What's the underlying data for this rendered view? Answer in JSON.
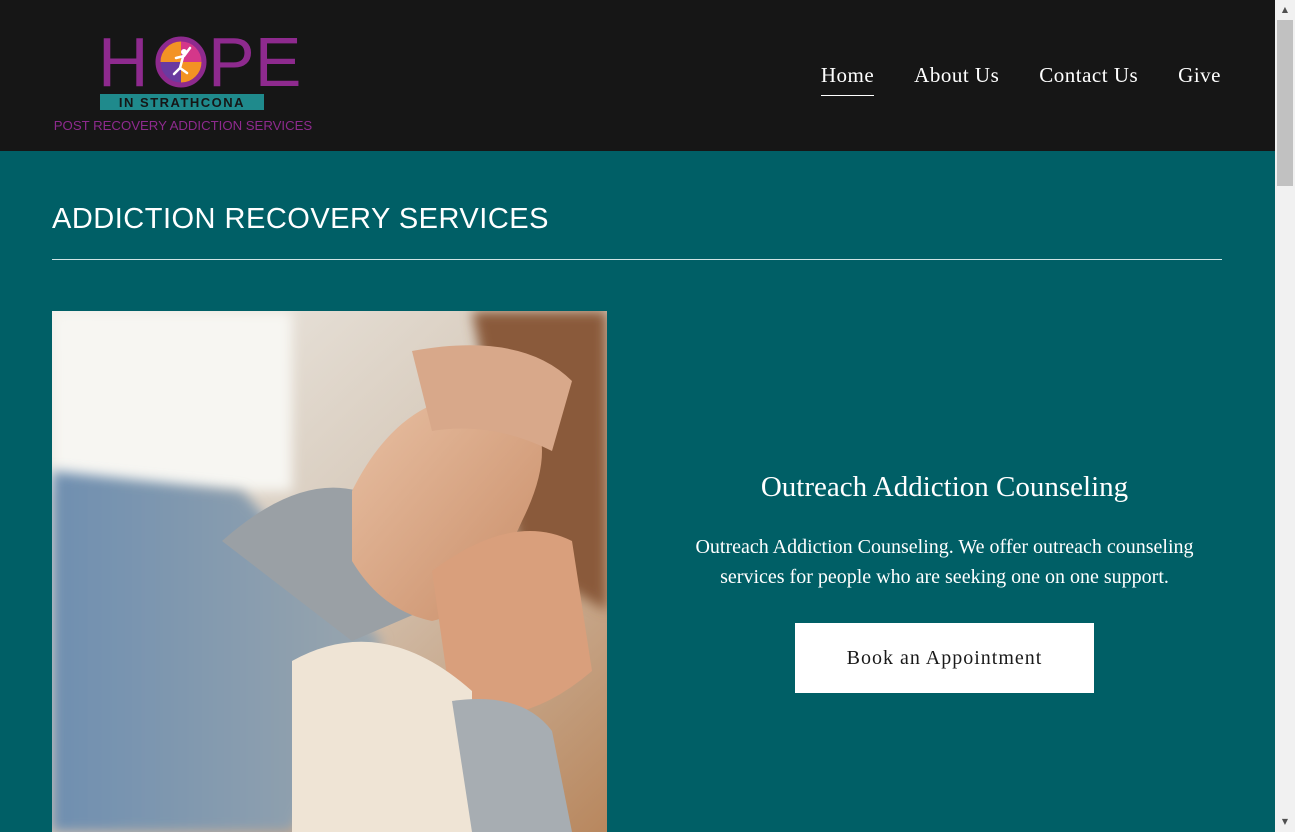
{
  "logo": {
    "hope": "HOPE",
    "in_strathcona": "IN STRATHCONA",
    "tagline": "POST RECOVERY ADDICTION SERVICES"
  },
  "nav": {
    "items": [
      "Home",
      "About Us",
      "Contact Us",
      "Give"
    ],
    "active": "Home"
  },
  "section": {
    "title": "ADDICTION RECOVERY SERVICES"
  },
  "service": {
    "title": "Outreach Addiction Counseling",
    "description": "Outreach Addiction Counseling. We  offer outreach counseling services for people who are seeking one on one support.",
    "button_label": "Book an Appointment"
  },
  "colors": {
    "header_bg": "#161616",
    "page_bg": "#005f66",
    "logo_purple": "#8e2a8e",
    "logo_teal": "#1f8a8c"
  },
  "icons": {
    "scroll_up": "▲",
    "scroll_down": "▼"
  }
}
